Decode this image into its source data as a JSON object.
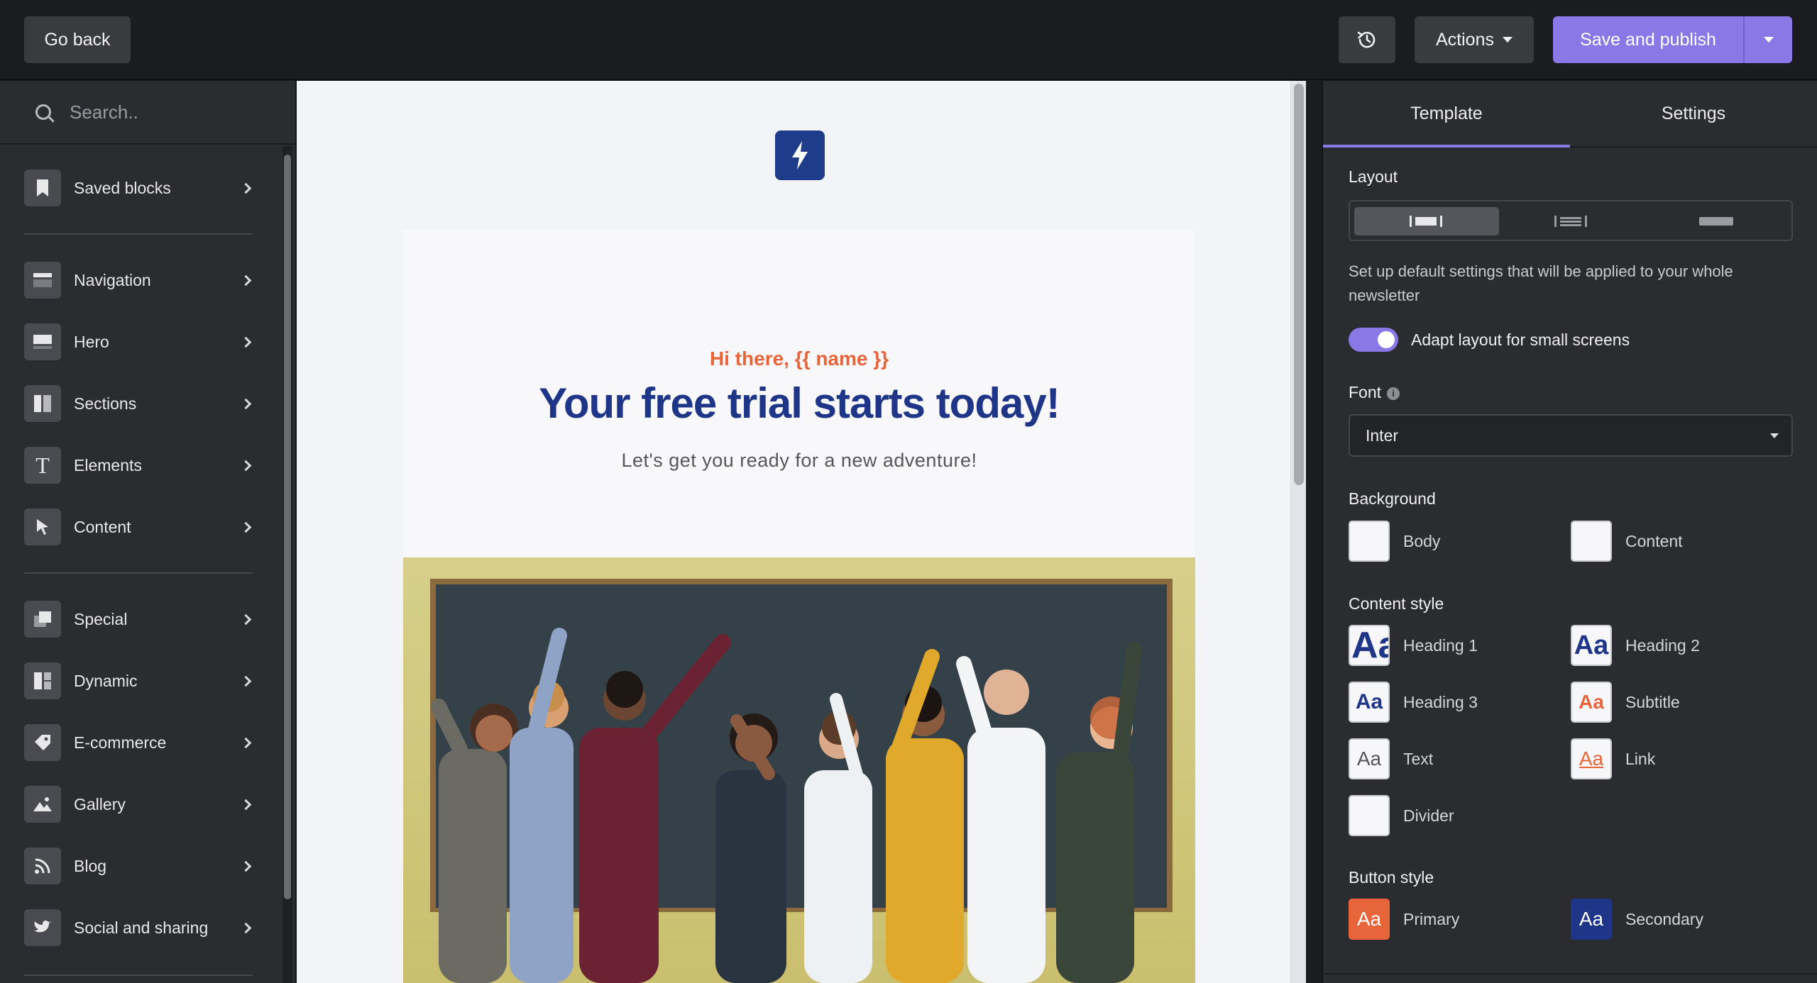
{
  "topbar": {
    "go_back": "Go back",
    "actions": "Actions",
    "save_publish": "Save and publish"
  },
  "left": {
    "search_placeholder": "Search..",
    "items": [
      {
        "label": "Saved blocks",
        "icon": "bookmark-icon"
      },
      {
        "label": "Navigation",
        "icon": "navigation-icon"
      },
      {
        "label": "Hero",
        "icon": "hero-icon"
      },
      {
        "label": "Sections",
        "icon": "sections-icon"
      },
      {
        "label": "Elements",
        "icon": "text-t-icon"
      },
      {
        "label": "Content",
        "icon": "pointer-icon"
      },
      {
        "label": "Special",
        "icon": "special-icon"
      },
      {
        "label": "Dynamic",
        "icon": "dynamic-icon"
      },
      {
        "label": "E-commerce",
        "icon": "tag-icon"
      },
      {
        "label": "Gallery",
        "icon": "image-icon"
      },
      {
        "label": "Blog",
        "icon": "rss-icon"
      },
      {
        "label": "Social and sharing",
        "icon": "twitter-icon"
      }
    ]
  },
  "email": {
    "greeting": "Hi there, {{ name }}",
    "headline": "Your free trial starts today!",
    "subtitle": "Let's get you ready for a new adventure!"
  },
  "right": {
    "tabs": [
      "Template",
      "Settings"
    ],
    "active_tab": "Template",
    "layout_label": "Layout",
    "description": "Set up default settings that will be applied to your whole newsletter",
    "toggle_label": "Adapt layout for small screens",
    "toggle_on": true,
    "font_label": "Font",
    "font_value": "Inter",
    "background_label": "Background",
    "bg_body": "Body",
    "bg_content": "Content",
    "content_style_label": "Content style",
    "heading1": "Heading 1",
    "heading2": "Heading 2",
    "heading3": "Heading 3",
    "subtitle": "Subtitle",
    "text": "Text",
    "link": "Link",
    "divider": "Divider",
    "button_style_label": "Button style",
    "primary": "Primary",
    "secondary": "Secondary",
    "swatch_text": "Aa"
  },
  "colors": {
    "accent": "#8a78e6",
    "brand_navy": "#1f3587",
    "brand_orange": "#e8643a"
  }
}
